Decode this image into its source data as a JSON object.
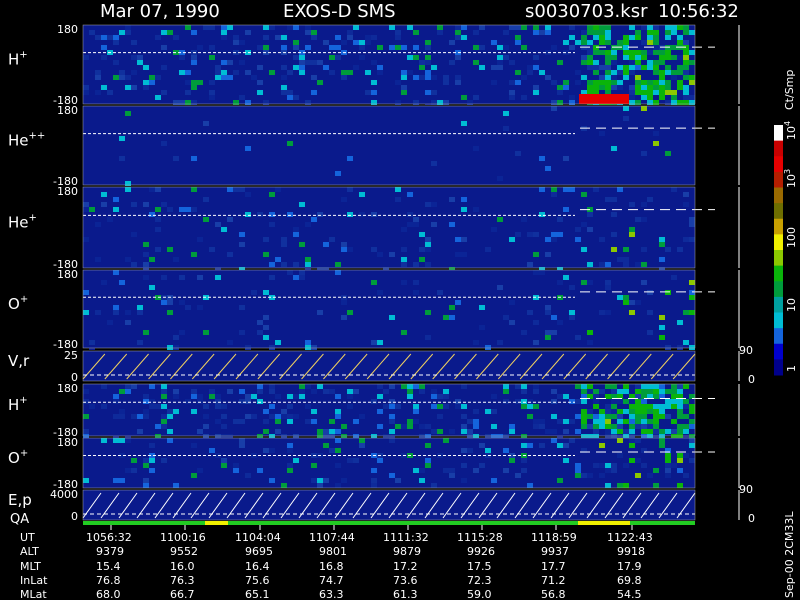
{
  "header": {
    "date": "Mar 07, 1990",
    "instrument": "EXOS-D SMS",
    "file": "s0030703.ksr",
    "time": "10:56:32"
  },
  "colorbar": {
    "unit": "Ct/Smp",
    "tick_labels": [
      "1",
      "10",
      "100",
      "10",
      "10"
    ],
    "tick_exponents": [
      "",
      "",
      "",
      "3",
      "4"
    ],
    "colors": [
      "#00008b",
      "#0000cd",
      "#1464dc",
      "#00bcd4",
      "#00a0a0",
      "#009c3c",
      "#0ab40a",
      "#8cc800",
      "#f0f000",
      "#c8a000",
      "#6e6e00",
      "#9a6a00",
      "#b41e00",
      "#e60000",
      "#c80000",
      "#ffffff"
    ]
  },
  "panels": [
    {
      "id": "h-plus-1",
      "label": "H",
      "sup": "+",
      "top": "180",
      "bottom": "-180",
      "kind": "spec",
      "activity": 0.75
    },
    {
      "id": "he-pp",
      "label": "He",
      "sup": "++",
      "top": "180",
      "bottom": "-180",
      "kind": "spec",
      "activity": 0.05
    },
    {
      "id": "he-plus",
      "label": "He",
      "sup": "+",
      "top": "180",
      "bottom": "-180",
      "kind": "spec",
      "activity": 0.3
    },
    {
      "id": "o-plus-1",
      "label": "O",
      "sup": "+",
      "top": "180",
      "bottom": "-180",
      "kind": "spec",
      "activity": 0.25
    },
    {
      "id": "vr",
      "label": "V,r",
      "sup": "",
      "top": "25",
      "bottom": "0",
      "kind": "line",
      "right_top": "90",
      "right_bottom": "0"
    },
    {
      "id": "h-plus-2",
      "label": "H",
      "sup": "+",
      "top": "180",
      "bottom": "-180",
      "kind": "spec",
      "activity": 0.85
    },
    {
      "id": "o-plus-2",
      "label": "O",
      "sup": "+",
      "top": "180",
      "bottom": "-180",
      "kind": "spec",
      "activity": 0.45
    },
    {
      "id": "ep",
      "label": "E,p",
      "sup": "",
      "top": "4000",
      "bottom": "0",
      "kind": "line2",
      "right_top": "90",
      "right_bottom": "0"
    }
  ],
  "qa_label": "QA",
  "footer": {
    "row_labels": [
      "UT",
      "ALT",
      "MLT",
      "InLat",
      "MLat"
    ],
    "columns": [
      [
        "1056:32",
        "9379",
        "15.4",
        "76.8",
        "68.0"
      ],
      [
        "1100:16",
        "9552",
        "16.0",
        "76.3",
        "66.7"
      ],
      [
        "1104:04",
        "9695",
        "16.4",
        "75.6",
        "65.1"
      ],
      [
        "1107:44",
        "9801",
        "16.8",
        "74.7",
        "63.3"
      ],
      [
        "1111:32",
        "9879",
        "17.2",
        "73.6",
        "61.3"
      ],
      [
        "1115:28",
        "9926",
        "17.5",
        "72.3",
        "59.0"
      ],
      [
        "1118:59",
        "9937",
        "17.7",
        "71.2",
        "56.8"
      ],
      [
        "1122:43",
        "9918",
        "17.9",
        "69.8",
        "54.5"
      ]
    ]
  },
  "side_note": "Sep-00 2CM33L",
  "chart_data": {
    "type": "heatmap",
    "title": "Mar 07, 1990   EXOS-D SMS",
    "x_ticks": [
      "1056:32",
      "1100:16",
      "1104:04",
      "1107:44",
      "1111:32",
      "1115:28",
      "1118:59",
      "1122:43"
    ],
    "series": [
      {
        "name": "H+",
        "ylim": [
          -180,
          180
        ]
      },
      {
        "name": "He++",
        "ylim": [
          -180,
          180
        ]
      },
      {
        "name": "He+",
        "ylim": [
          -180,
          180
        ]
      },
      {
        "name": "O+",
        "ylim": [
          -180,
          180
        ]
      },
      {
        "name": "V,r",
        "ylim": [
          0,
          25
        ]
      },
      {
        "name": "H+",
        "ylim": [
          -180,
          180
        ]
      },
      {
        "name": "O+",
        "ylim": [
          -180,
          180
        ]
      },
      {
        "name": "E,p",
        "ylim": [
          0,
          4000
        ]
      }
    ],
    "colorbar_unit": "Ct/Smp",
    "colorbar_range": [
      1,
      10000
    ],
    "log_scale": true
  }
}
